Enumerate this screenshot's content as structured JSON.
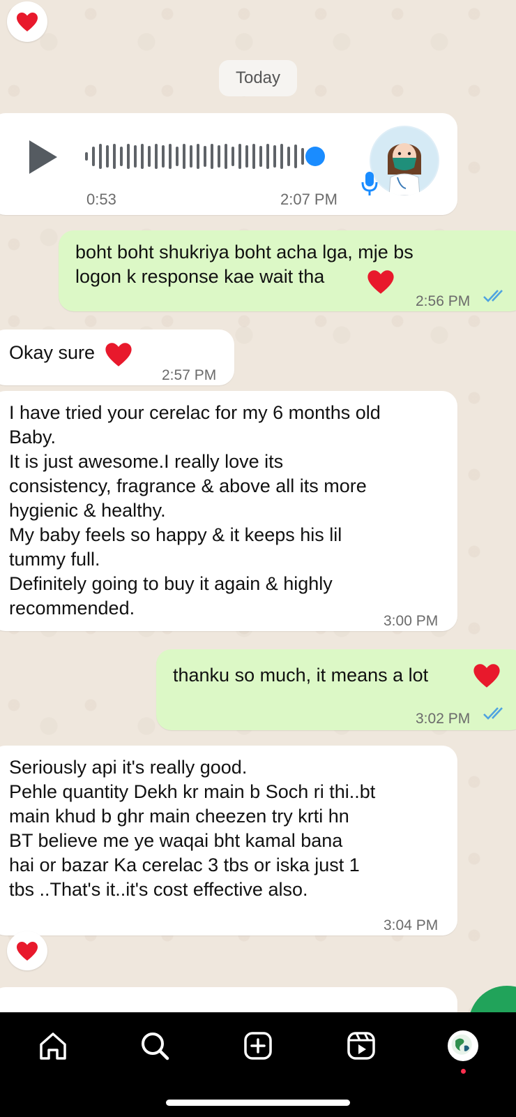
{
  "chat": {
    "date_separator": "Today",
    "voice_note": {
      "duration": "0:53",
      "time": "2:07 PM",
      "played_fraction": 1.0
    },
    "messages": [
      {
        "direction": "outgoing",
        "text": "boht boht shukriya boht acha lga, mje bs\nlogon k response kae wait tha",
        "time": "2:56 PM",
        "status": "read"
      },
      {
        "direction": "incoming",
        "text": "Okay sure",
        "time": "2:57 PM"
      },
      {
        "direction": "incoming",
        "text": "I have tried your cerelac for my 6 months old\nBaby.\nIt is just awesome.I really love its\nconsistency, fragrance & above all its more\nhygienic & healthy.\nMy baby feels so happy & it keeps his lil\ntummy full.\nDefinitely going to buy it again & highly\nrecommended.",
        "time": "3:00 PM"
      },
      {
        "direction": "outgoing",
        "text": "thanku so much, it means a lot",
        "time": "3:02 PM",
        "status": "read"
      },
      {
        "direction": "incoming",
        "text": "Seriously api it's really good.\nPehle quantity Dekh kr main b Soch ri thi..bt\nmain khud b ghr main cheezen try krti hn\nBT believe me ye waqai bht kamal bana\nhai or bazar Ka cerelac 3 tbs or iska just 1\ntbs ..That's it..it's cost effective also.",
        "time": "3:04 PM"
      }
    ],
    "reactions": [
      "heart",
      "heart"
    ]
  },
  "bottom_nav": {
    "items": [
      "home-icon",
      "search-icon",
      "create-icon",
      "reels-icon",
      "profile-avatar"
    ]
  },
  "colors": {
    "chat_background": "#efe7dd",
    "incoming_bubble": "#ffffff",
    "outgoing_bubble": "#dcf8c6",
    "read_ticks": "#4fa3e0",
    "voice_progress": "#1a8cff",
    "heart": "#e8192c",
    "nav_background": "#000000"
  }
}
